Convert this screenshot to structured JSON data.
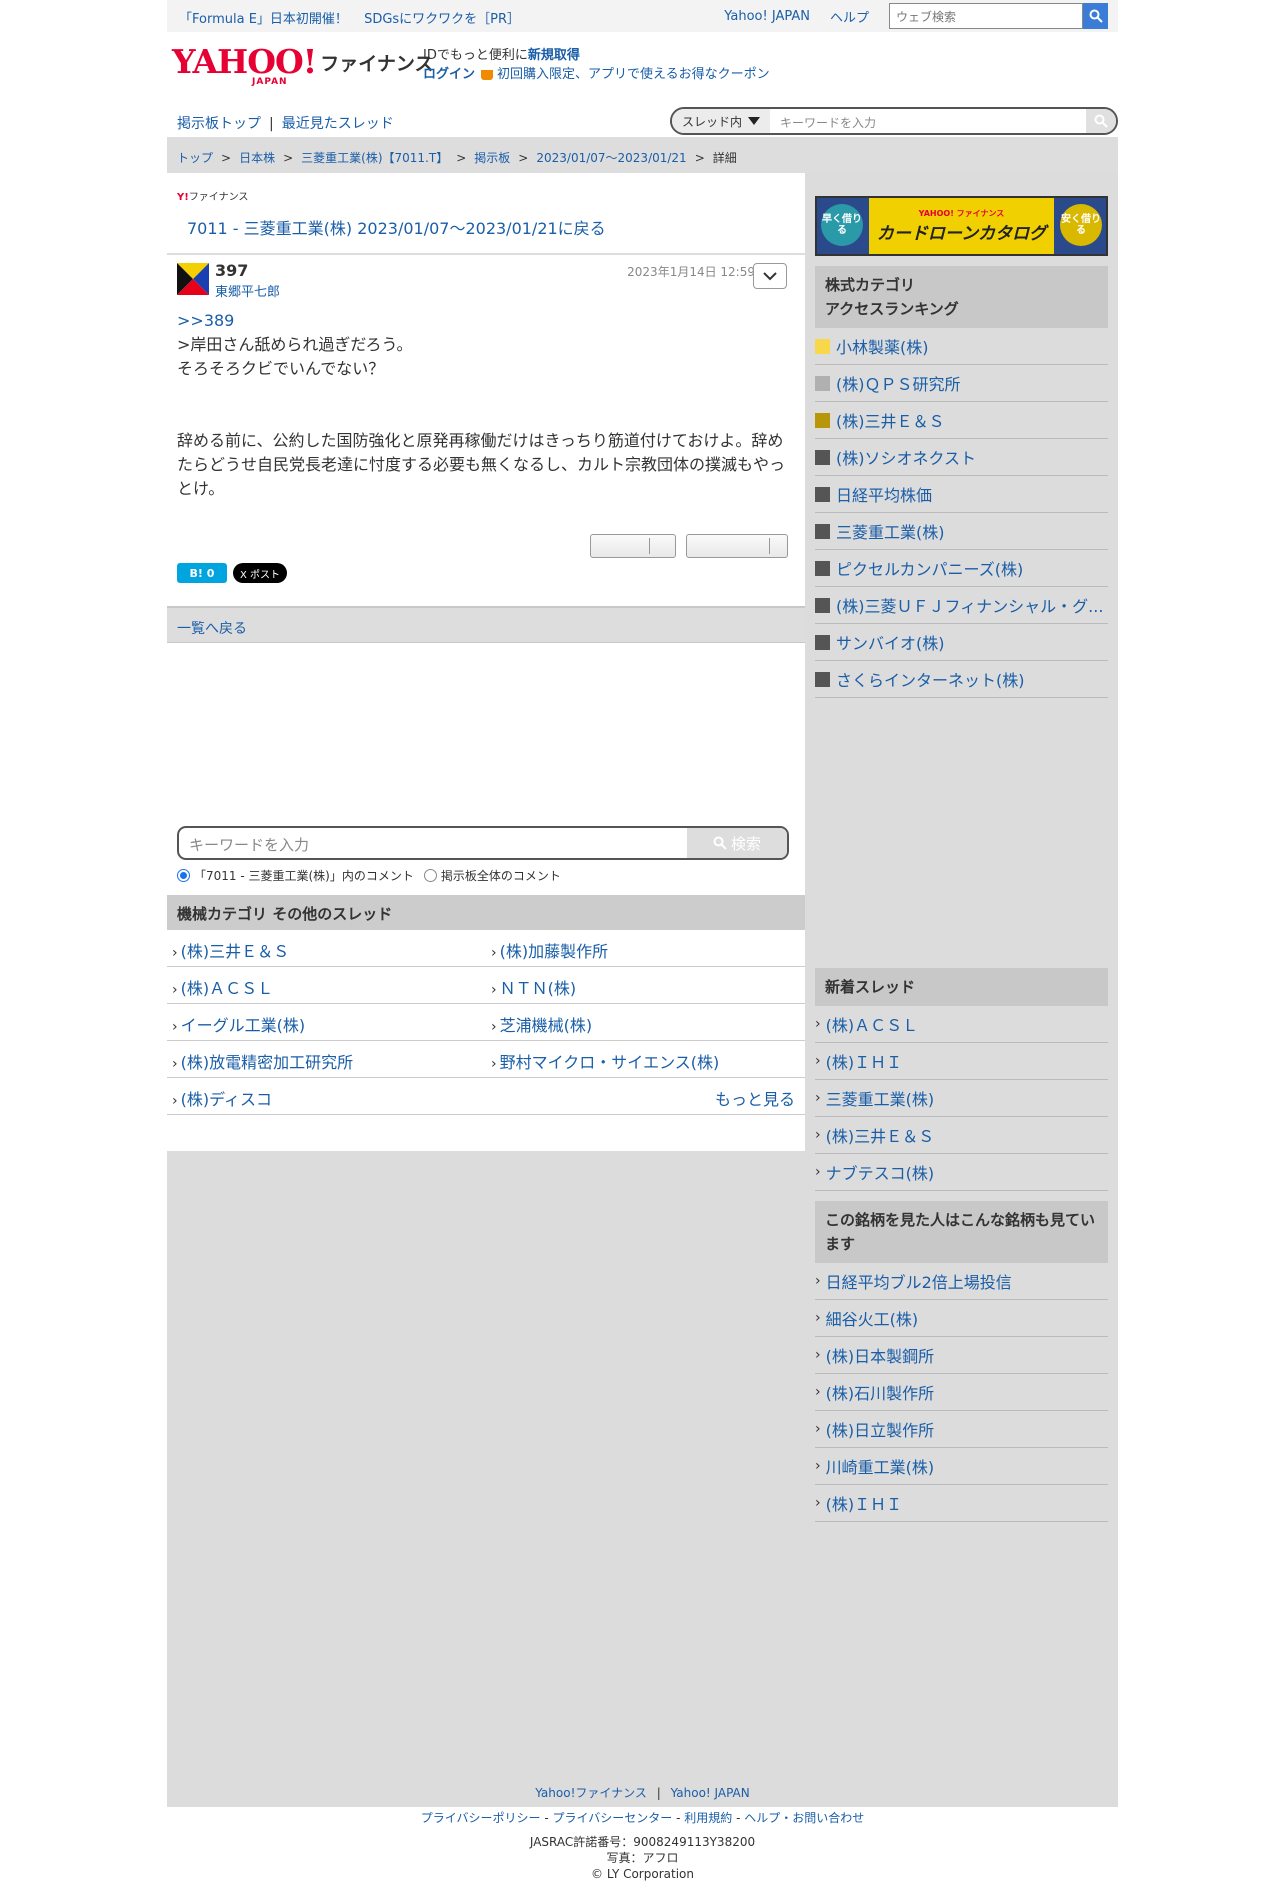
{
  "topbar": {
    "pr1": "「Formula E」日本初開催！",
    "pr2": "SDGsにワクワクを［PR］",
    "link1": "Yahoo! JAPAN",
    "link2": "ヘルプ",
    "search_placeholder": "ウェブ検索"
  },
  "header": {
    "logo_main": "YAHOO!",
    "logo_sub": "JAPAN",
    "logo_service": "ファイナンス",
    "line1_text": "IDでもっと便利に",
    "line1_link": "新規取得",
    "login": "ログイン",
    "coupon": "初回購入限定、アプリで使えるお得なクーポン"
  },
  "nav": {
    "board_top": "掲示板トップ",
    "sep": "|",
    "recent": "最近見たスレッド",
    "scope": "スレッド内",
    "placeholder": "キーワードを入力"
  },
  "breadcrumb": [
    "トップ",
    "日本株",
    "三菱重工業(株)【7011.T】",
    "掲示板",
    "2023/01/07〜2023/01/21",
    "詳細"
  ],
  "thread": {
    "mini_logo_y": "Y!",
    "mini_logo_text": "ファイナンス",
    "back_title": "7011 - 三菱重工業(株) 2023/01/07〜2023/01/21に戻る"
  },
  "post": {
    "number": "397",
    "user": "東郷平七郎",
    "date": "2023年1月14日 12:59",
    "reply": ">>389",
    "line1": ">岸田さん舐められ過ぎだろう。",
    "line2": "そろそろクビでいんでない？",
    "para2": "辞める前に、公約した国防強化と原発再稼働だけはきっちり筋道付けておけよ。辞めたらどうせ自民党長老達に忖度する必要も無くなるし、カルト宗教団体の撲滅もやっとけ。",
    "hatena_count": "B! 0",
    "x_label": "X ポスト"
  },
  "back_list": "一覧へ戻る",
  "keyword_search": {
    "placeholder": "キーワードを入力",
    "button": "検索",
    "opt1": "「7011 - 三菱重工業(株)」内のコメント",
    "opt2": "掲示板全体のコメント"
  },
  "other_threads": {
    "title": "機械カテゴリ  その他のスレッド",
    "items": [
      "(株)三井Ｅ＆Ｓ",
      "(株)加藤製作所",
      "(株)ＡＣＳＬ",
      "ＮＴＮ(株)",
      "イーグル工業(株)",
      "芝浦機械(株)",
      "(株)放電精密加工研究所",
      "野村マイクロ・サイエンス(株)",
      "(株)ディスコ"
    ],
    "more": "もっと見る"
  },
  "banner": {
    "left": "早く借りる",
    "right": "安く借りる",
    "small": "YAHOO! ファイナンス",
    "big": "カードローンカタログ"
  },
  "ranking": {
    "title_line1": "株式カテゴリ",
    "title_line2": "アクセスランキング",
    "colors": [
      "#f7d84a",
      "#b0b0b0",
      "#b8960a",
      "#555555",
      "#555555",
      "#555555",
      "#555555",
      "#555555",
      "#555555",
      "#555555"
    ],
    "items": [
      "小林製薬(株)",
      "(株)ＱＰＳ研究所",
      "(株)三井Ｅ＆Ｓ",
      "(株)ソシオネクスト",
      "日経平均株価",
      "三菱重工業(株)",
      "ピクセルカンパニーズ(株)",
      "(株)三菱ＵＦＪフィナンシャル・グ...",
      "サンバイオ(株)",
      "さくらインターネット(株)"
    ]
  },
  "new_threads": {
    "title": "新着スレッド",
    "items": [
      "(株)ＡＣＳＬ",
      "(株)ＩＨＩ",
      "三菱重工業(株)",
      "(株)三井Ｅ＆Ｓ",
      "ナブテスコ(株)"
    ]
  },
  "also_viewed": {
    "title": "この銘柄を見た人はこんな銘柄も見ています",
    "items": [
      "日経平均ブル2倍上場投信",
      "細谷火工(株)",
      "(株)日本製鋼所",
      "(株)石川製作所",
      "(株)日立製作所",
      "川崎重工業(株)",
      "(株)ＩＨＩ"
    ]
  },
  "footer": {
    "link1": "Yahoo!ファイナンス",
    "link2": "Yahoo! JAPAN",
    "privacy_policy": "プライバシーポリシー",
    "privacy_center": "プライバシーセンター",
    "terms": "利用規約",
    "help": "ヘルプ・お問い合わせ",
    "jasrac": "JASRAC許諾番号：9008249113Y38200",
    "photo": "写真：アフロ",
    "copyright": "© LY Corporation"
  }
}
